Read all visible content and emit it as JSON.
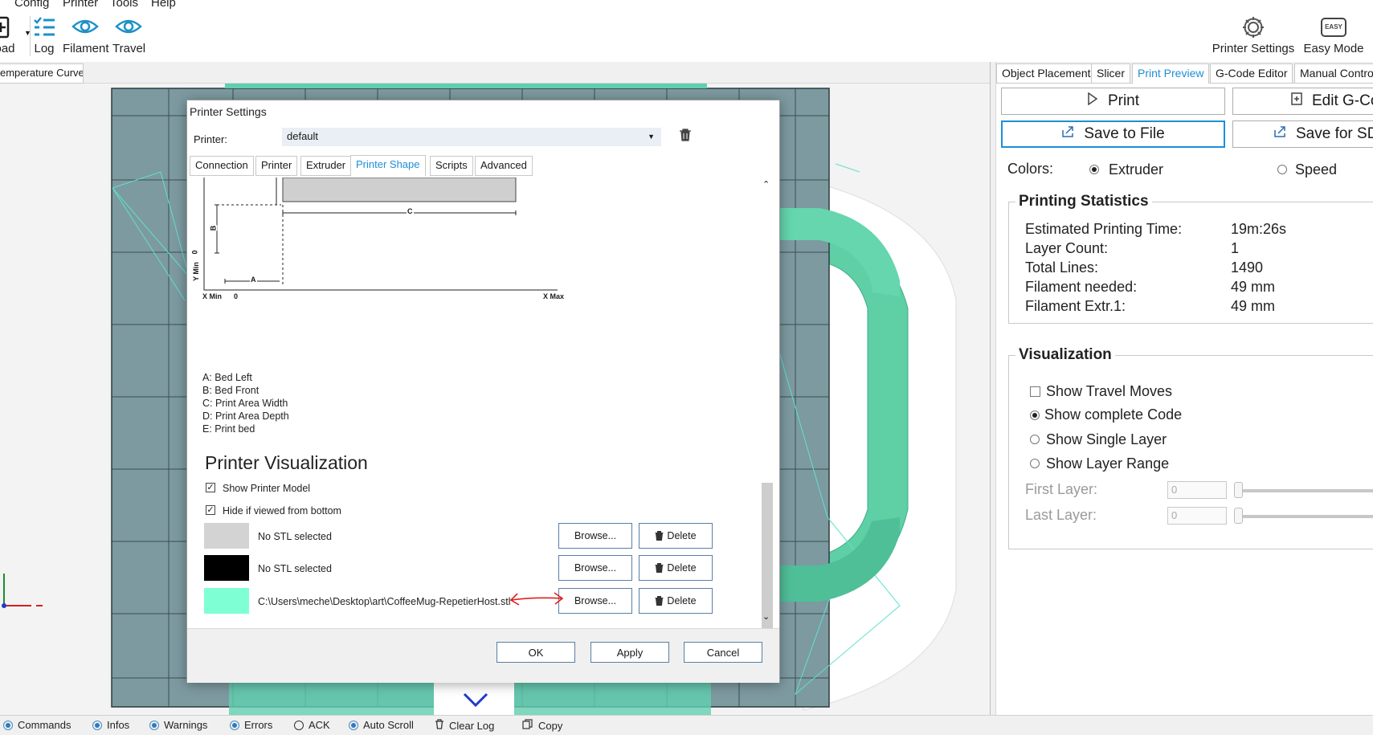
{
  "menu": {
    "items": [
      "Config",
      "Printer",
      "Tools",
      "Help"
    ]
  },
  "toolbar": {
    "load_label": "oad",
    "log_label": "Log",
    "filament_label": "Filament",
    "travel_label": "Travel",
    "printer_settings_label": "Printer Settings",
    "easy_mode_label": "Easy Mode",
    "easy_badge": "EASY"
  },
  "left_tab": {
    "label": "emperature Curve"
  },
  "right_tabs": {
    "object_placement": "Object Placement",
    "slicer": "Slicer",
    "print_preview": "Print Preview",
    "gcode_editor": "G-Code Editor",
    "manual_control": "Manual Control"
  },
  "right_panel": {
    "print_label": "Print",
    "edit_gcode_label": "Edit G-Co",
    "save_to_file_label": "Save to File",
    "save_for_sd_label": "Save for SD",
    "colors_label": "Colors:",
    "extruder_label": "Extruder",
    "speed_label": "Speed",
    "stats_title": "Printing Statistics",
    "stats": [
      {
        "label": "Estimated Printing Time:",
        "value": "19m:26s"
      },
      {
        "label": "Layer Count:",
        "value": "1"
      },
      {
        "label": "Total Lines:",
        "value": "1490"
      },
      {
        "label": "Filament needed:",
        "value": "49 mm"
      },
      {
        "label": "Filament Extr.1:",
        "value": "49 mm"
      }
    ],
    "viz_title": "Visualization",
    "show_travel": "Show Travel Moves",
    "show_complete": "Show complete Code",
    "show_single": "Show Single Layer",
    "show_range": "Show Layer Range",
    "first_layer": "First Layer:",
    "last_layer": "Last Layer:",
    "first_layer_value": "0",
    "last_layer_value": "0"
  },
  "dialog": {
    "title": "Printer Settings",
    "printer_label": "Printer:",
    "printer_value": "default",
    "tabs": {
      "connection": "Connection",
      "printer": "Printer",
      "extruder": "Extruder",
      "printer_shape": "Printer Shape",
      "scripts": "Scripts",
      "advanced": "Advanced"
    },
    "diagram": {
      "c": "C",
      "b": "B",
      "a": "A",
      "ymin": "Y Min",
      "zero_y": "0",
      "zero_x": "0",
      "xmin": "X Min",
      "xmax": "X Max"
    },
    "legend": [
      "A: Bed Left",
      "B: Bed Front",
      "C: Print Area Width",
      "D: Print Area Depth",
      "E: Print bed"
    ],
    "viz_title": "Printer Visualization",
    "show_model": "Show Printer Model",
    "hide_bottom": "Hide if viewed from bottom",
    "stl_rows": [
      {
        "text": "No STL selected",
        "color": "#d3d3d3"
      },
      {
        "text": "No STL selected",
        "color": "#000000"
      },
      {
        "text": "C:\\Users\\meche\\Desktop\\art\\CoffeeMug-RepetierHost.stl",
        "color": "#7fffd4"
      }
    ],
    "browse_label": "Browse...",
    "delete_label": "Delete",
    "ok_label": "OK",
    "apply_label": "Apply",
    "cancel_label": "Cancel"
  },
  "status_bar": {
    "commands": "Commands",
    "infos": "Infos",
    "warnings": "Warnings",
    "errors": "Errors",
    "ack": "ACK",
    "auto_scroll": "Auto Scroll",
    "clear_log": "Clear Log",
    "copy": "Copy"
  },
  "colors": {
    "accent": "#1e8fd6",
    "toolbar_icon": "#1e90c8",
    "bed": "#7d9aa0",
    "model": "#4fcca0",
    "annotation_arrow": "#e02020"
  }
}
